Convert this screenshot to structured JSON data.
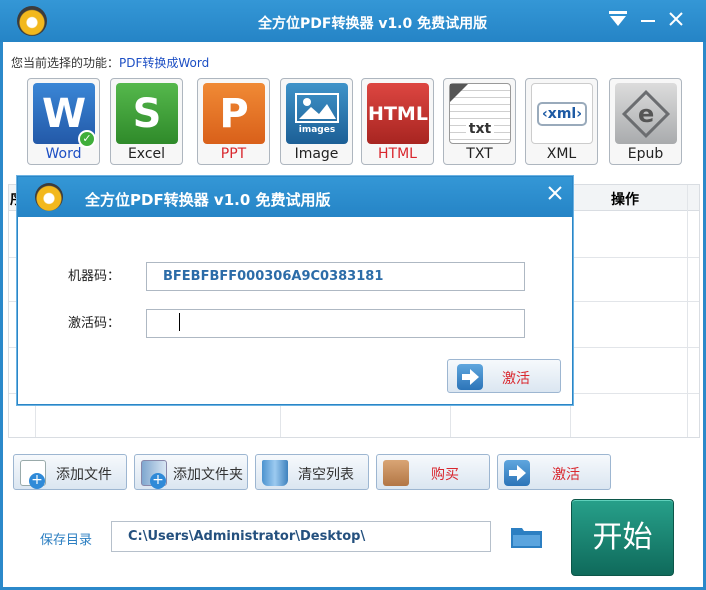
{
  "window": {
    "title": "全方位PDF转换器 v1.0 免费试用版"
  },
  "current_function": {
    "label": "您当前选择的功能：",
    "value": "PDF转换成Word"
  },
  "formats": [
    {
      "label": "Word",
      "icon": "word-icon",
      "glyph": "W",
      "color": "#2f6fbf",
      "selected": true
    },
    {
      "label": "Excel",
      "icon": "excel-icon",
      "glyph": "S",
      "color": "#3e9b37",
      "selected": false
    },
    {
      "label": "PPT",
      "icon": "ppt-icon",
      "glyph": "P",
      "color": "#e36d1d",
      "selected": false
    },
    {
      "label": "Image",
      "icon": "image-icon",
      "glyph": "images",
      "color": "#2e78b0",
      "selected": false
    },
    {
      "label": "HTML",
      "icon": "html-icon",
      "glyph": "HTML",
      "color": "#c9302c",
      "selected": false
    },
    {
      "label": "TXT",
      "icon": "txt-icon",
      "glyph": "txt",
      "color": "#ffffff",
      "selected": false
    },
    {
      "label": "XML",
      "icon": "xml-icon",
      "glyph": "‹xml›",
      "color": "#ffffff",
      "selected": false
    },
    {
      "label": "Epub",
      "icon": "epub-icon",
      "glyph": "e",
      "color": "#8d8f91",
      "selected": false
    }
  ],
  "table": {
    "first_col_label": "序",
    "action_col_label": "操作"
  },
  "toolbar": {
    "add_file": "添加文件",
    "add_folder": "添加文件夹",
    "clear_list": "清空列表",
    "buy": "购买",
    "activate": "激活"
  },
  "save": {
    "label": "保存目录",
    "path": "C:\\Users\\Administrator\\Desktop\\"
  },
  "start_label": "开始",
  "dialog": {
    "title": "全方位PDF转换器 v1.0  免费试用版",
    "machine_code_label": "机器码：",
    "machine_code_value": "BFEBFBFF000306A9C0383181",
    "activation_code_label": "激活码：",
    "activation_code_value": "",
    "activate_button": "激活"
  },
  "colors": {
    "titlebar": "#2b89ca",
    "accent_blue": "#1d4fc4",
    "start_green": "#167a69",
    "red_label": "#d9272e"
  }
}
